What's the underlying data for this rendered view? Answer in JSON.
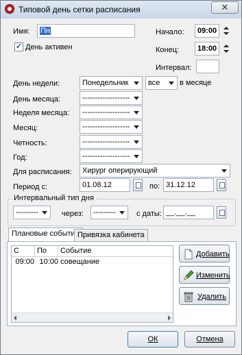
{
  "window": {
    "title": "Типовой день сетки расписания",
    "close_glyph": "✕"
  },
  "fields": {
    "name": {
      "label": "Имя:",
      "value": "Пн"
    },
    "day_active": {
      "label": "День активен",
      "checked": true
    },
    "start": {
      "label": "Начало:",
      "value": "09:00"
    },
    "end": {
      "label": "Конец:",
      "value": "18:00"
    },
    "interval": {
      "label": "Интервал:",
      "value": ""
    },
    "weekday": {
      "label": "День недели:",
      "value": "Понедельник",
      "qualifier": "все",
      "suffix": "в месяце"
    },
    "month_day": {
      "label": "День месяца:",
      "value": "-------------------"
    },
    "month_week": {
      "label": "Неделя месяца:",
      "value": "-------------------"
    },
    "month": {
      "label": "Месяц:",
      "value": "-------------------"
    },
    "parity": {
      "label": "Четность:",
      "value": "-------------------"
    },
    "year": {
      "label": "Год:",
      "value": "-------------------"
    },
    "schedule": {
      "label": "Для расписания:",
      "value": "Хирург оперирующий"
    },
    "period": {
      "label": "Период с:",
      "from": "01.08.12",
      "to_label": "по:",
      "to": "31.12.12"
    }
  },
  "interval_group": {
    "title": "Интервальный тип дня",
    "type_value": "---------",
    "through_label": "через:",
    "through_value": "---------",
    "from_date_label": "с даты:",
    "from_date_value": "__.__.__"
  },
  "tabs": [
    {
      "label": "Плановые события",
      "active": true
    },
    {
      "label": "Привязка кабинета",
      "active": false
    }
  ],
  "events_table": {
    "columns": [
      "С",
      "По",
      "Событие"
    ],
    "rows": [
      {
        "from": "09:00",
        "to": "10:00",
        "event": "совещание"
      }
    ]
  },
  "side_buttons": {
    "add": "Добавить",
    "edit": "Изменить",
    "delete": "Удалить"
  },
  "footer": {
    "ok": "ОК",
    "cancel": "Отмена"
  },
  "colors": {
    "title_bg": "#c8d6e8",
    "window_bg": "#f0f0f0",
    "border": "#a3aebd"
  }
}
